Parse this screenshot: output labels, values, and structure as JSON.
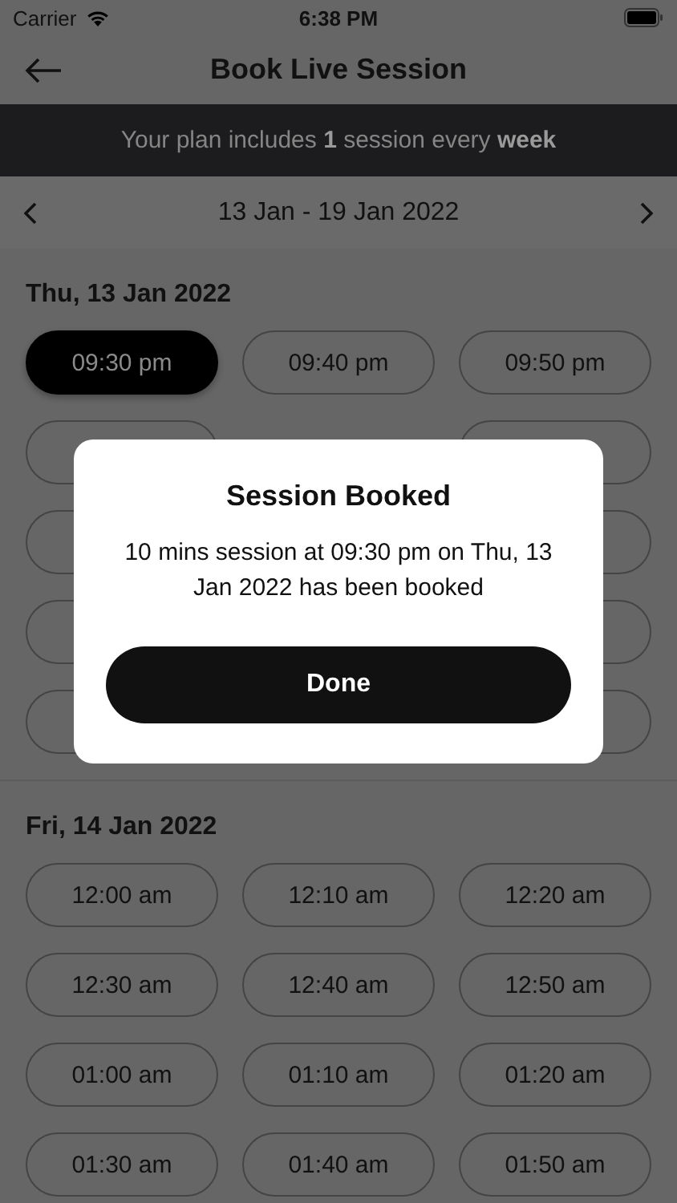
{
  "status_bar": {
    "carrier": "Carrier",
    "time": "6:38 PM"
  },
  "nav": {
    "title": "Book Live Session"
  },
  "banner": {
    "text": "Your plan includes **1** session every **week**"
  },
  "week": {
    "range": "13 Jan - 19 Jan 2022"
  },
  "days": [
    {
      "date": "Thu, 13 Jan 2022",
      "slots": [
        {
          "kind": "time",
          "label": "09:30 pm",
          "selected": true
        },
        {
          "kind": "time",
          "label": "09:40 pm",
          "selected": false
        },
        {
          "kind": "time",
          "label": "09:50 pm",
          "selected": false
        },
        {
          "kind": "covered"
        },
        {
          "kind": "covered"
        },
        {
          "kind": "covered"
        },
        {
          "kind": "covered"
        },
        {
          "kind": "covered"
        },
        {
          "kind": "covered"
        },
        {
          "kind": "covered"
        },
        {
          "kind": "covered"
        }
      ]
    },
    {
      "date": "Fri, 14 Jan 2022",
      "slots": [
        {
          "label": "12:00 am",
          "selected": false
        },
        {
          "label": "12:10 am",
          "selected": false
        },
        {
          "label": "12:20 am",
          "selected": false
        },
        {
          "label": "12:30 am",
          "selected": false
        },
        {
          "label": "12:40 am",
          "selected": false
        },
        {
          "label": "12:50 am",
          "selected": false
        },
        {
          "label": "01:00 am",
          "selected": false
        },
        {
          "label": "01:10 am",
          "selected": false
        },
        {
          "label": "01:20 am",
          "selected": false
        },
        {
          "label": "01:30 am",
          "selected": false
        },
        {
          "label": "01:40 am",
          "selected": false
        },
        {
          "label": "01:50 am",
          "selected": false
        }
      ]
    }
  ],
  "dialog": {
    "title": "Session Booked",
    "message": "10 mins session at 09:30 pm on Thu, 13 Jan 2022 has been booked",
    "button": "Done"
  }
}
